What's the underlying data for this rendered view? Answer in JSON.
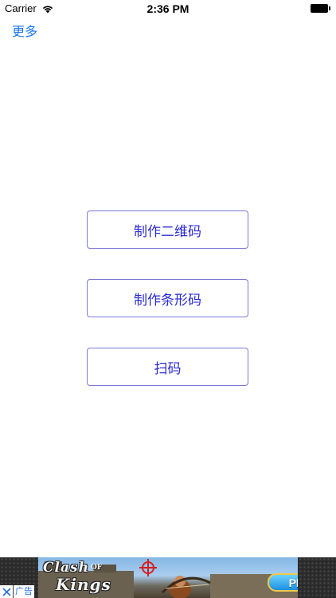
{
  "status_bar": {
    "carrier": "Carrier",
    "time": "2:36 PM",
    "icons": [
      "wifi-icon",
      "battery-icon"
    ]
  },
  "nav": {
    "more_label": "更多"
  },
  "actions": {
    "make_qr_label": "制作二维码",
    "make_barcode_label": "制作条形码",
    "scan_label": "扫码"
  },
  "ad": {
    "logo_line1": "Clash",
    "logo_of": "OF",
    "logo_line2": "Kings",
    "play_label": "Play",
    "ad_label": "广告",
    "close_icon": "close-icon"
  },
  "colors": {
    "link_blue": "#1a76f2",
    "button_text": "#2b2bd1",
    "button_border": "#7a7ad6"
  }
}
